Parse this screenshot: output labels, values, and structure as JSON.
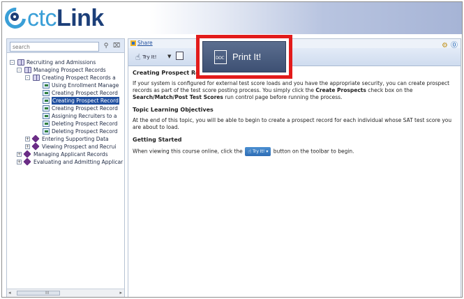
{
  "header": {
    "logo_prefix": "ctc",
    "logo_suffix": "Link"
  },
  "sidebar": {
    "search_placeholder": "search",
    "tree": [
      {
        "label": "Recruiting and Admissions",
        "level": 0,
        "icon": "book-icon",
        "expand": "-",
        "selected": false
      },
      {
        "label": "Managing Prospect Records",
        "level": 1,
        "icon": "book-icon",
        "expand": "-",
        "selected": false
      },
      {
        "label": "Creating Prospect Records a",
        "level": 2,
        "icon": "book-icon",
        "expand": "-",
        "selected": false
      },
      {
        "label": "Using Enrollment Manage",
        "level": 3,
        "icon": "page-icon",
        "expand": "",
        "selected": false
      },
      {
        "label": "Creating Prospect Record",
        "level": 3,
        "icon": "page-icon",
        "expand": "",
        "selected": false
      },
      {
        "label": "Creating Prospect Record",
        "level": 3,
        "icon": "page-icon",
        "expand": "",
        "selected": true
      },
      {
        "label": "Creating Prospect Record",
        "level": 3,
        "icon": "page-icon",
        "expand": "",
        "selected": false
      },
      {
        "label": "Assigning Recruiters to a",
        "level": 3,
        "icon": "page-icon",
        "expand": "",
        "selected": false
      },
      {
        "label": "Deleting Prospect Record",
        "level": 3,
        "icon": "page-icon",
        "expand": "",
        "selected": false
      },
      {
        "label": "Deleting Prospect Record",
        "level": 3,
        "icon": "page-icon",
        "expand": "",
        "selected": false
      },
      {
        "label": "Entering Supporting Data",
        "level": 2,
        "icon": "diamond-icon",
        "expand": "+",
        "selected": false
      },
      {
        "label": "Viewing Prospect and Recrui",
        "level": 2,
        "icon": "diamond-icon",
        "expand": "+",
        "selected": false
      },
      {
        "label": "Managing Applicant Records",
        "level": 1,
        "icon": "diamond-icon",
        "expand": "+",
        "selected": false
      },
      {
        "label": "Evaluating and Admitting Applicar",
        "level": 1,
        "icon": "diamond-icon",
        "expand": "+",
        "selected": false
      }
    ]
  },
  "main": {
    "share_label": "Share",
    "toolbar": {
      "tryit_label": "Try It!"
    },
    "callout_label": "Print It!",
    "doc_icon_text": "DOC",
    "section1_title": "Creating Prospect Re",
    "section1_text_a": "If your system is configured for external test score loads and you have the appropriate security, you can create prospect records as part of the test score posting process. You simply click the ",
    "section1_bold_a": "Create Prospects",
    "section1_text_b": " check box on the ",
    "section1_bold_b": "Search/Match/Post Test Scores",
    "section1_text_c": " run control page before running the process.",
    "section2_title": "Topic Learning Objectives",
    "section2_text": "At the end of this topic, you will be able to begin to create a prospect record for each individual whose SAT test score you are about to load.",
    "section3_title": "Getting Started",
    "section3_text_a": "When viewing this course online, click the ",
    "section3_button": "Try It!",
    "section3_text_b": " button on the toolbar to begin."
  },
  "colors": {
    "selection": "#1f4fa0",
    "callout_border": "#e21b1b",
    "logo_blue": "#3a9fd7",
    "logo_navy": "#1c3f79"
  }
}
